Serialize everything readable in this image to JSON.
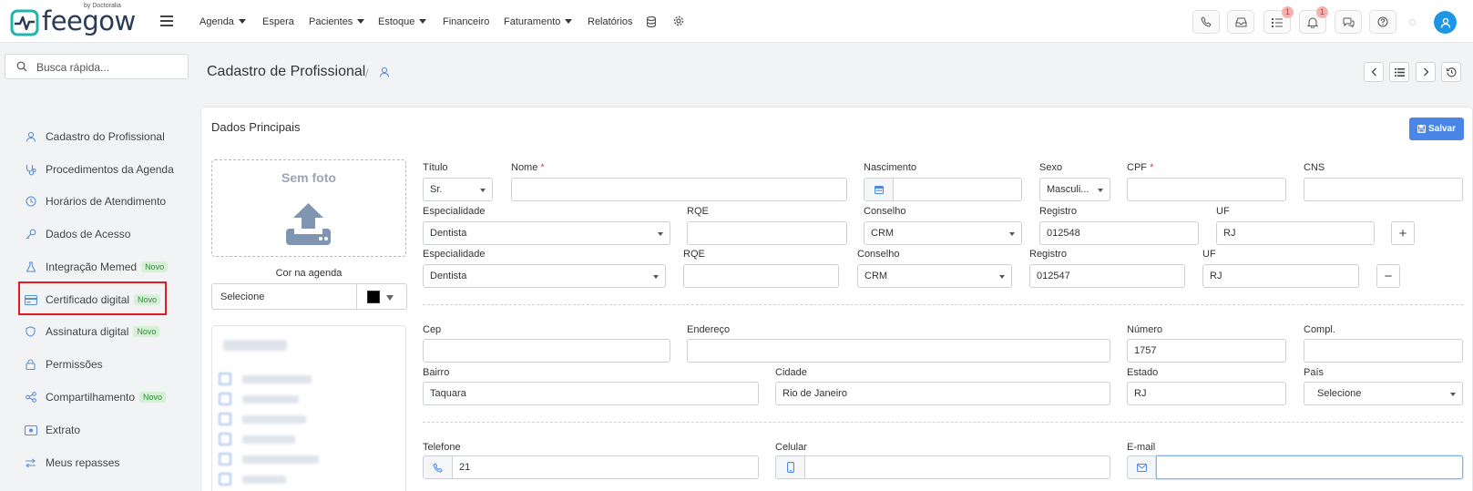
{
  "brand": {
    "name": "feegow",
    "sub": "by Doctoralia"
  },
  "nav": [
    {
      "label": "Agenda",
      "dropdown": true
    },
    {
      "label": "Espera",
      "dropdown": false
    },
    {
      "label": "Pacientes",
      "dropdown": true
    },
    {
      "label": "Estoque",
      "dropdown": true
    },
    {
      "label": "Financeiro",
      "dropdown": false
    },
    {
      "label": "Faturamento",
      "dropdown": true
    },
    {
      "label": "Relatórios",
      "dropdown": false
    }
  ],
  "badges": {
    "tasks": "1",
    "notifications": "1"
  },
  "search": {
    "placeholder": "Busca rápida..."
  },
  "sidebar": [
    {
      "label": "Cadastro do Profissional",
      "icon": "user-icon",
      "novo": false
    },
    {
      "label": "Procedimentos da Agenda",
      "icon": "stethoscope-icon",
      "novo": false
    },
    {
      "label": "Horários de Atendimento",
      "icon": "clock-icon",
      "novo": false
    },
    {
      "label": "Dados de Acesso",
      "icon": "key-icon",
      "novo": false
    },
    {
      "label": "Integração Memed",
      "icon": "flask-icon",
      "novo": true
    },
    {
      "label": "Certificado digital",
      "icon": "card-icon",
      "novo": true
    },
    {
      "label": "Assinatura digital",
      "icon": "shield-icon",
      "novo": true
    },
    {
      "label": "Permissões",
      "icon": "lock-icon",
      "novo": false
    },
    {
      "label": "Compartilhamento",
      "icon": "share-icon",
      "novo": true
    },
    {
      "label": "Extrato",
      "icon": "money-icon",
      "novo": false
    },
    {
      "label": "Meus repasses",
      "icon": "transfer-icon",
      "novo": false
    }
  ],
  "novo_label": "Novo",
  "page": {
    "title": "Cadastro de Profissional",
    "sep": "/"
  },
  "card": {
    "title": "Dados Principais",
    "save": "Salvar"
  },
  "photo": {
    "label": "Sem foto",
    "cor_label": "Cor na agenda",
    "cor_value": "Selecione",
    "cor_color": "#000000"
  },
  "form": {
    "titulo": {
      "label": "Título",
      "value": "Sr."
    },
    "nome": {
      "label": "Nome",
      "value": ""
    },
    "nascimento": {
      "label": "Nascimento",
      "value": ""
    },
    "sexo": {
      "label": "Sexo",
      "value": "Masculi..."
    },
    "cpf": {
      "label": "CPF",
      "value": ""
    },
    "cns": {
      "label": "CNS",
      "value": ""
    },
    "esp1": {
      "label": "Especialidade",
      "value": "Dentista"
    },
    "rqe1": {
      "label": "RQE",
      "value": ""
    },
    "conselho1": {
      "label": "Conselho",
      "value": "CRM"
    },
    "registro1": {
      "label": "Registro",
      "value": "012548"
    },
    "uf1": {
      "label": "UF",
      "value": "RJ"
    },
    "esp2": {
      "label": "Especialidade",
      "value": "Dentista"
    },
    "rqe2": {
      "label": "RQE",
      "value": ""
    },
    "conselho2": {
      "label": "Conselho",
      "value": "CRM"
    },
    "registro2": {
      "label": "Registro",
      "value": "012547"
    },
    "uf2": {
      "label": "UF",
      "value": "RJ"
    },
    "cep": {
      "label": "Cep",
      "value": ""
    },
    "endereco": {
      "label": "Endereço",
      "value": ""
    },
    "numero": {
      "label": "Número",
      "value": "1757"
    },
    "compl": {
      "label": "Compl.",
      "value": ""
    },
    "bairro": {
      "label": "Bairro",
      "value": "Taquara"
    },
    "cidade": {
      "label": "Cidade",
      "value": "Rio de Janeiro"
    },
    "estado": {
      "label": "Estado",
      "value": "RJ"
    },
    "pais": {
      "label": "País",
      "value": "Selecione"
    },
    "telefone": {
      "label": "Telefone",
      "value": "21"
    },
    "celular": {
      "label": "Celular",
      "value": ""
    },
    "email": {
      "label": "E-mail",
      "value": ""
    },
    "add": "+",
    "remove": "−",
    "required_mark": "*"
  },
  "colors": {
    "accent": "#4a86e8",
    "highlight": "#e01b24",
    "avatar": "#1e96e6"
  }
}
